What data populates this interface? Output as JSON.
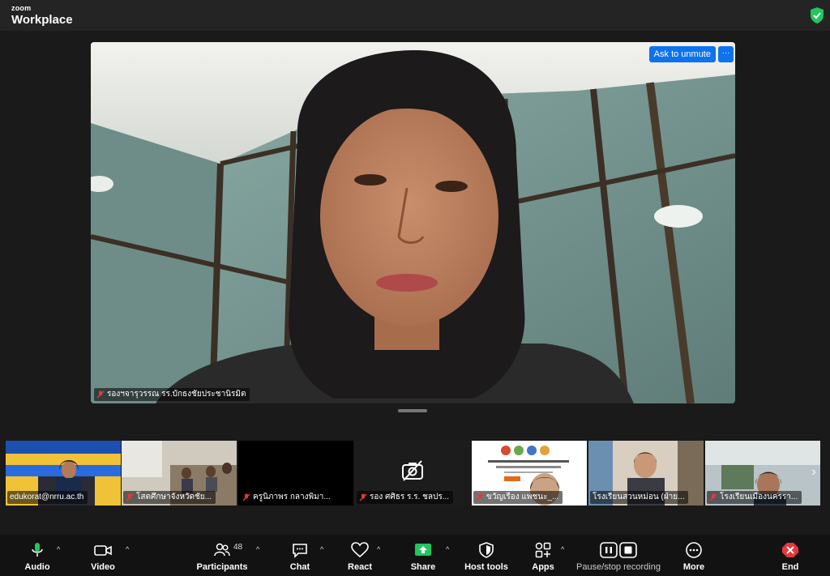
{
  "app": {
    "brand_small": "zoom",
    "brand_big": "Workplace"
  },
  "main_video": {
    "ask_unmute": "Ask to unmute",
    "more": "···",
    "participant_name": "รองฯจารุวรรณ รร.บักธงชัยประชานิรมิต"
  },
  "thumbnails": [
    {
      "name": "edukorat@nrru.ac.th",
      "muted": false
    },
    {
      "name": "โสตศึกษาจังหวัดชัย...",
      "muted": true
    },
    {
      "name": "ครูนิภาพร กลางพิมา...",
      "muted": true
    },
    {
      "name": "รอง ศศิธร ร.ร. ชลปร...",
      "muted": true
    },
    {
      "name": "ขวัญเรือง แพชนะ_...",
      "muted": true
    },
    {
      "name": "โรงเรียนสวนหม่อน (ฝ่าย...",
      "muted": false
    },
    {
      "name": "โรงเรียนเมืองนครรา...",
      "muted": true
    }
  ],
  "toolbar": {
    "audio": "Audio",
    "video": "Video",
    "participants": "Participants",
    "participants_count": "48",
    "chat": "Chat",
    "react": "React",
    "share": "Share",
    "host_tools": "Host tools",
    "apps": "Apps",
    "recording": "Pause/stop recording",
    "more": "More",
    "end": "End"
  },
  "colors": {
    "accent": "#0e72ed",
    "share_green": "#22c55e",
    "end_red": "#e5383b",
    "shield_green": "#22c55e"
  }
}
